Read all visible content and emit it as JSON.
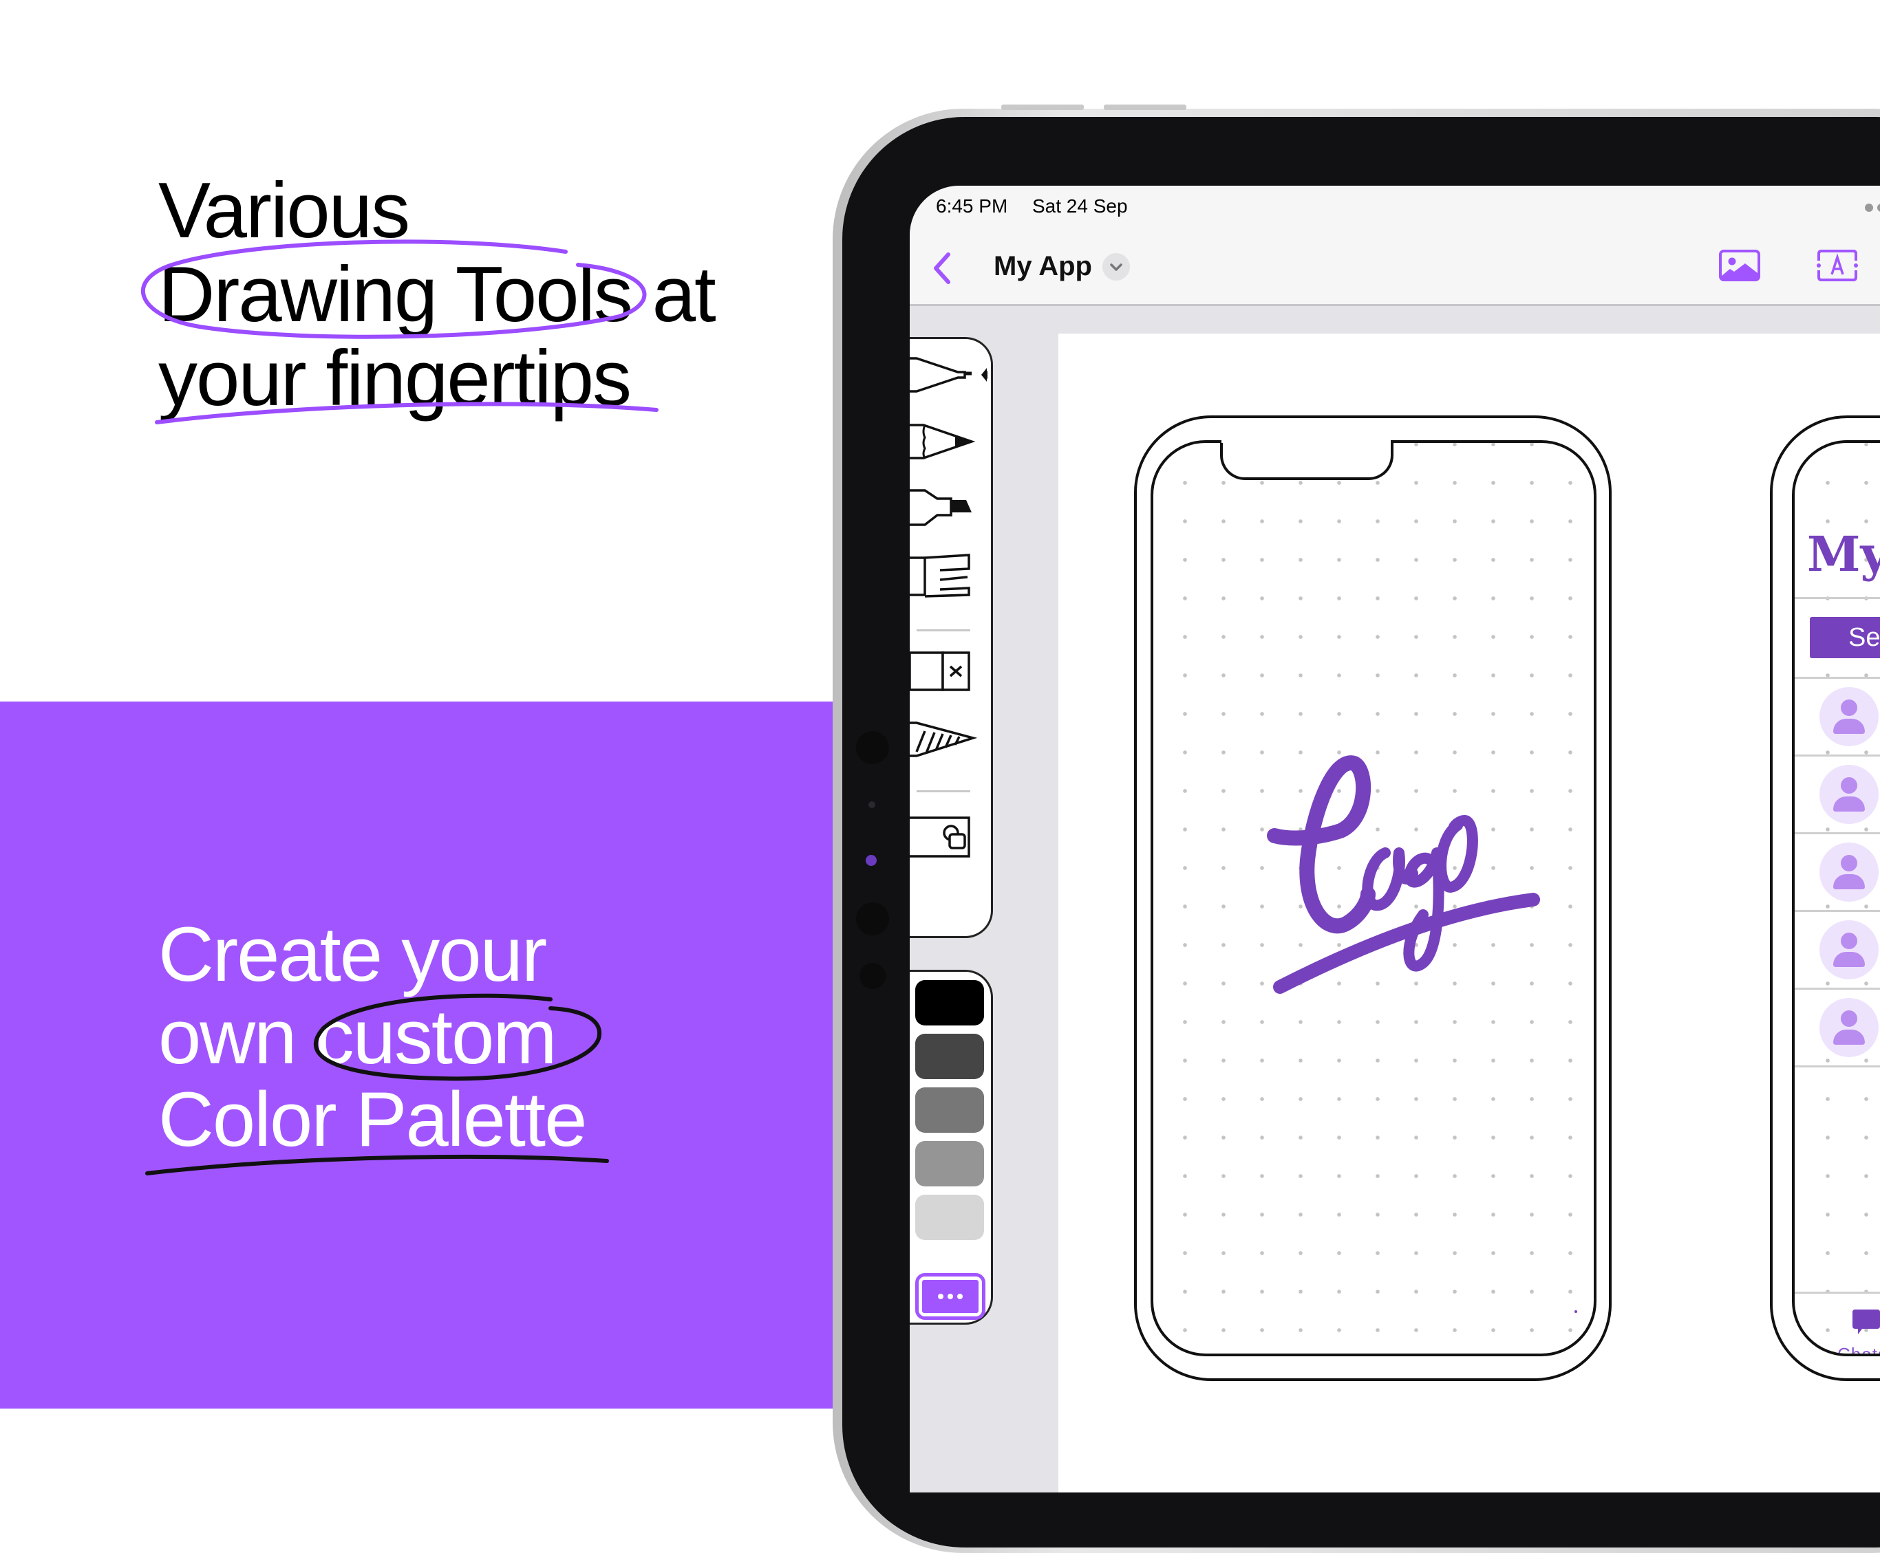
{
  "theme": {
    "accent": "#A155FF",
    "accent_dark": "#7641BC",
    "headline_mark_color": "#9B4DFF",
    "bezel": "#111113"
  },
  "marketing": {
    "headline_top": [
      "Various",
      "Drawing Tools at",
      "your fingertips"
    ],
    "headline_top_circled": "Drawing Tools",
    "headline_top_underlined": "your fingertips",
    "headline_bottom": [
      "Create your",
      "own custom",
      "Color Palette"
    ],
    "headline_bottom_circled": "custom",
    "headline_bottom_underlined": "Color Palette"
  },
  "status_bar": {
    "time": "6:45 PM",
    "date": "Sat 24 Sep",
    "multitasking_icon": "ellipsis-dots"
  },
  "nav_bar": {
    "back_icon": "chevron-left",
    "title": "My App",
    "title_menu_icon": "chevron-down",
    "actions": [
      {
        "name": "insert-image",
        "icon": "photo-icon"
      },
      {
        "name": "insert-text",
        "icon": "text-box-icon"
      }
    ]
  },
  "tools": {
    "selected": "fineliner",
    "items": [
      {
        "id": "fineliner",
        "icon": "fineliner-pen-icon"
      },
      {
        "id": "pencil",
        "icon": "pencil-icon"
      },
      {
        "id": "marker",
        "icon": "marker-icon"
      },
      {
        "id": "brush",
        "icon": "brush-icon"
      },
      {
        "id": "eraser",
        "icon": "eraser-icon"
      },
      {
        "id": "hatch-pencil",
        "icon": "hatched-pencil-icon"
      },
      {
        "id": "shapes",
        "icon": "shapes-icon"
      }
    ]
  },
  "palette": {
    "colors": [
      "#000000",
      "#454545",
      "#777777",
      "#959595",
      "#d6d6d6"
    ],
    "more_button_icon": "more-horizontal-icon"
  },
  "canvas": {
    "sketch_text": "Logo",
    "sketch_color": "#7641BC",
    "right_phone": {
      "title_partial": "My",
      "segment_partial": "Seg",
      "list_rows": 5,
      "tab_label_partial": "Chats",
      "tab_icon": "chat-bubble-icon"
    }
  }
}
